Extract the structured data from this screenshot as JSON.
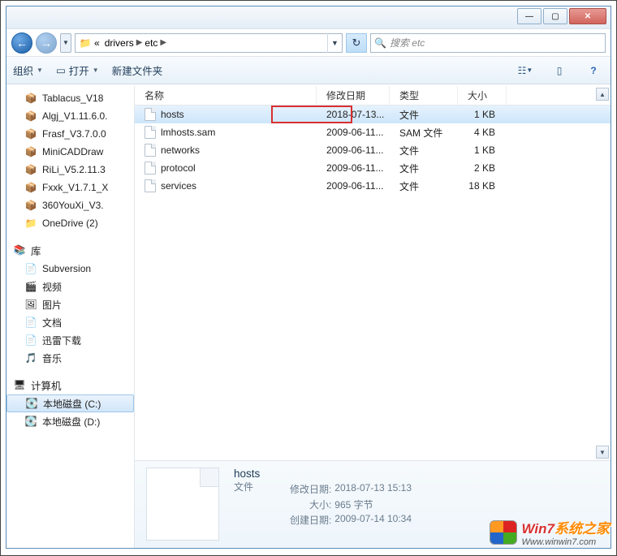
{
  "titlebar": {
    "min": "—",
    "max": "▢",
    "close": "✕"
  },
  "nav": {
    "back": "←",
    "fwd": "→",
    "drop": "▼"
  },
  "breadcrumb": {
    "prefix": "«",
    "seg1": "drivers",
    "seg2": "etc"
  },
  "search": {
    "placeholder": "搜索 etc"
  },
  "toolbar": {
    "organize": "组织",
    "open": "打开",
    "newfolder": "新建文件夹"
  },
  "sidebar": {
    "items1": [
      {
        "label": "Tablacus_V18",
        "icon": "📦"
      },
      {
        "label": "Algj_V1.11.6.0.",
        "icon": "📦"
      },
      {
        "label": "Frasf_V3.7.0.0",
        "icon": "📦"
      },
      {
        "label": "MiniCADDraw",
        "icon": "📦"
      },
      {
        "label": "RiLi_V5.2.11.3",
        "icon": "📦"
      },
      {
        "label": "Fxxk_V1.7.1_X",
        "icon": "📦"
      },
      {
        "label": "360YouXi_V3.",
        "icon": "📦"
      },
      {
        "label": "OneDrive (2)",
        "icon": "📁"
      }
    ],
    "lib": "库",
    "items2": [
      {
        "label": "Subversion",
        "icon": "📄"
      },
      {
        "label": "视频",
        "icon": "🎬"
      },
      {
        "label": "图片",
        "icon": "🖼"
      },
      {
        "label": "文档",
        "icon": "📄"
      },
      {
        "label": "迅雷下载",
        "icon": "📄"
      },
      {
        "label": "音乐",
        "icon": "🎵"
      }
    ],
    "computer": "计算机",
    "drives": [
      {
        "label": "本地磁盘 (C:)",
        "icon": "💽"
      },
      {
        "label": "本地磁盘 (D:)",
        "icon": "💽"
      }
    ]
  },
  "columns": {
    "name": "名称",
    "date": "修改日期",
    "type": "类型",
    "size": "大小"
  },
  "files": [
    {
      "name": "hosts",
      "date": "2018-07-13...",
      "type": "文件",
      "size": "1 KB",
      "selected": true
    },
    {
      "name": "lmhosts.sam",
      "date": "2009-06-11...",
      "type": "SAM 文件",
      "size": "4 KB"
    },
    {
      "name": "networks",
      "date": "2009-06-11...",
      "type": "文件",
      "size": "1 KB"
    },
    {
      "name": "protocol",
      "date": "2009-06-11...",
      "type": "文件",
      "size": "2 KB"
    },
    {
      "name": "services",
      "date": "2009-06-11...",
      "type": "文件",
      "size": "18 KB"
    }
  ],
  "details": {
    "filename": "hosts",
    "filetype": "文件",
    "labels": {
      "modified": "修改日期:",
      "size": "大小:",
      "created": "创建日期:"
    },
    "modified": "2018-07-13 15:13",
    "size": "965 字节",
    "created": "2009-07-14 10:34"
  },
  "watermark": {
    "t1a": "Win7",
    "t1b": "系统之家",
    "t2": "Www.winwin7.com"
  }
}
